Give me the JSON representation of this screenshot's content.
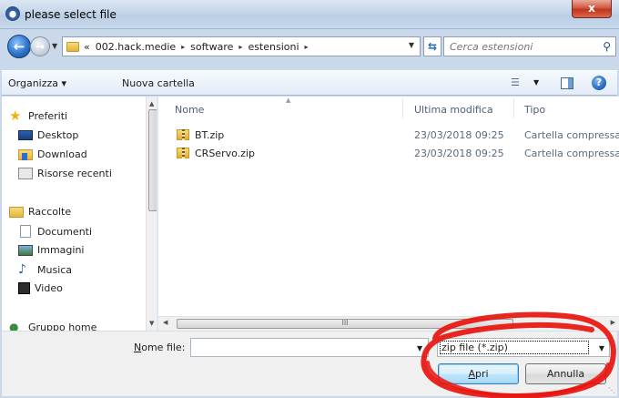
{
  "window": {
    "title": "please select file",
    "close_label": "x"
  },
  "address_bar": {
    "history_marker": "«",
    "breadcrumb": [
      "002.hack.medie",
      "software",
      "estensioni"
    ],
    "separator": "▸",
    "search_placeholder": "Cerca estensioni"
  },
  "toolbar": {
    "organize_label": "Organizza ▾",
    "new_folder_label": "Nuova cartella",
    "help_label": "?"
  },
  "nav_pane": {
    "favorites_header": "Preferiti",
    "favorites": [
      "Desktop",
      "Download",
      "Risorse recenti"
    ],
    "libraries_header": "Raccolte",
    "libraries": [
      "Documenti",
      "Immagini",
      "Musica",
      "Video"
    ],
    "homegroup": "Gruppo home"
  },
  "file_list": {
    "columns": [
      "Nome",
      "Ultima modifica",
      "Tipo"
    ],
    "files": [
      {
        "name": "BT.zip",
        "modified": "23/03/2018 09:25",
        "type": "Cartella compressa"
      },
      {
        "name": "CRServo.zip",
        "modified": "23/03/2018 09:25",
        "type": "Cartella compressa"
      }
    ],
    "hscroll_grip": "III"
  },
  "bottom": {
    "filename_label_underlined": "N",
    "filename_label_rest": "ome file:",
    "filename_value": "",
    "filter_value": "zip file (*.zip)",
    "open_label_underlined": "A",
    "open_label_rest": "pri",
    "cancel_label": "Annulla"
  },
  "colors": {
    "annotation_red": "#e8140e",
    "selection_blue": "#3c7fb1"
  },
  "icons": {
    "title": "app-globe-icon",
    "back": "back-arrow-icon",
    "forward": "forward-arrow-icon",
    "refresh": "refresh-icon",
    "search": "search-icon",
    "folder": "folder-icon",
    "zip": "zip-folder-icon"
  }
}
